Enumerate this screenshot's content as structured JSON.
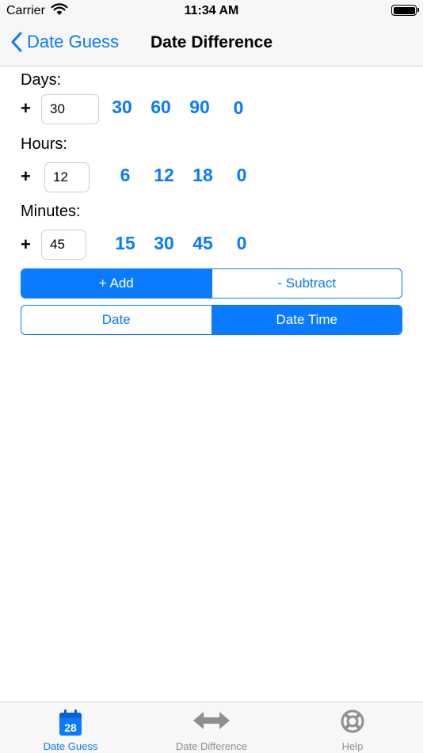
{
  "status_bar": {
    "carrier": "Carrier",
    "time": "11:34 AM"
  },
  "nav": {
    "back_label": "Date Guess",
    "title": "Date Difference"
  },
  "days": {
    "label": "Days:",
    "sign": "+",
    "value": "30",
    "quick": [
      "30",
      "60",
      "90",
      "0"
    ]
  },
  "hours": {
    "label": "Hours:",
    "sign": "+",
    "value": "12",
    "quick": [
      "6",
      "12",
      "18",
      "0"
    ]
  },
  "minutes": {
    "label": "Minutes:",
    "sign": "+",
    "value": "45",
    "quick": [
      "15",
      "30",
      "45",
      "0"
    ]
  },
  "operation": {
    "options": [
      "+ Add",
      "- Subtract"
    ],
    "selected": "+ Add"
  },
  "mode": {
    "options": [
      "Date",
      "Date Time"
    ],
    "selected": "Date Time"
  },
  "tabbar": {
    "tabs": [
      {
        "label": "Date Guess",
        "icon": "calendar-icon",
        "icon_text": "28",
        "active": true
      },
      {
        "label": "Date Difference",
        "icon": "double-arrow-icon",
        "active": false
      },
      {
        "label": "Help",
        "icon": "lifebuoy-icon",
        "active": false
      }
    ]
  },
  "colors": {
    "accent": "#0a7aff",
    "bar_bg": "#f7f7f7",
    "inactive_tab": "#8e8e93"
  }
}
